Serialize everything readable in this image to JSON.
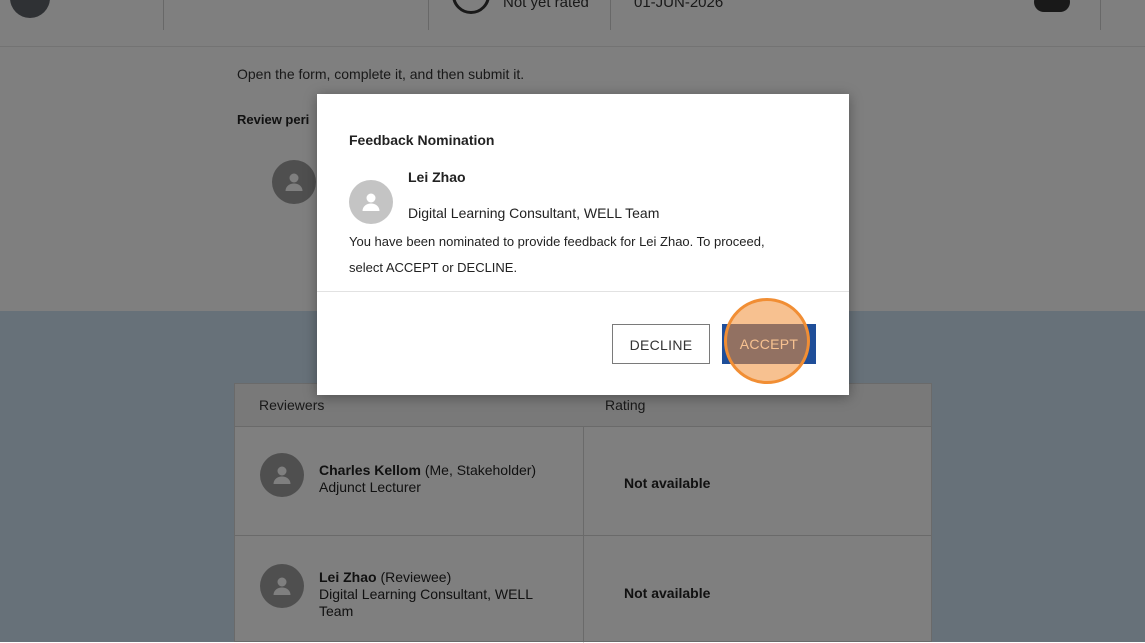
{
  "header": {
    "rating_status": "Not yet rated",
    "date": "01-JUN-2026"
  },
  "form": {
    "instructions": "Open the form, complete it, and then submit it.",
    "review_period_label": "Review peri"
  },
  "reviewers_table": {
    "columns": [
      "Reviewers",
      "Rating"
    ],
    "rows": [
      {
        "name": "Charles Kellom",
        "tag": "(Me, Stakeholder)",
        "role": "Adjunct Lecturer",
        "rating": "Not available"
      },
      {
        "name": "Lei Zhao",
        "tag": "(Reviewee)",
        "role_line1": "Digital Learning Consultant, WELL",
        "role_line2": "Team",
        "rating": "Not available"
      }
    ]
  },
  "modal": {
    "title": "Feedback Nomination",
    "nominee_name": "Lei Zhao",
    "nominee_role": "Digital Learning Consultant, WELL Team",
    "message_line1": "You have been nominated to provide feedback for Lei Zhao. To proceed,",
    "message_line2": "select ACCEPT or DECLINE.",
    "decline_label": "DECLINE",
    "accept_label": "ACCEPT"
  },
  "colors": {
    "accent": "#1f4e99",
    "highlight": "#f18e34",
    "band": "#cfe3f2"
  },
  "icons": [
    "user-avatar-icon"
  ]
}
